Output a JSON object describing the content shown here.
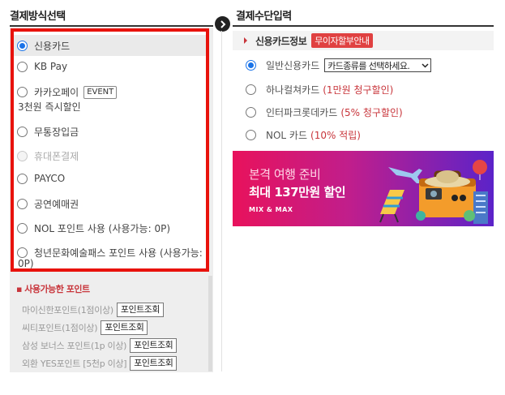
{
  "left_panel": {
    "title": "결제방식선택",
    "payment_methods": [
      {
        "label": "신용카드",
        "selected": true,
        "disabled": false
      },
      {
        "label": "KB Pay",
        "selected": false,
        "disabled": false
      },
      {
        "label": "카카오페이",
        "badge": "EVENT",
        "sub_text": "3천원 즉시할인",
        "selected": false,
        "disabled": false
      },
      {
        "label": "무통장입금",
        "selected": false,
        "disabled": false
      },
      {
        "label": "휴대폰결제",
        "selected": false,
        "disabled": true
      },
      {
        "label": "PAYCO",
        "selected": false,
        "disabled": false
      },
      {
        "label": "공연예매권",
        "selected": false,
        "disabled": false
      },
      {
        "label": "NOL 포인트 사용 (사용가능: 0P)",
        "selected": false,
        "disabled": false
      },
      {
        "label": "청년문화예술패스 포인트 사용 (사용가능:",
        "label_cont": "0P)",
        "selected": false,
        "disabled": false
      }
    ],
    "points": {
      "title": "사용가능한 포인트",
      "rows": [
        {
          "label": "마이신한포인트(1점이상)",
          "button": "포인트조회"
        },
        {
          "label": "씨티포인트(1점이상)",
          "button": "포인트조회"
        },
        {
          "label": "삼성 보너스 포인트(1p 이상)",
          "button": "포인트조회"
        },
        {
          "label": "외환 YES포인트 [5천p 이상]",
          "button": "포인트조회"
        }
      ]
    }
  },
  "right_panel": {
    "title": "결제수단입력",
    "card_info": {
      "label": "신용카드정보",
      "badge": "무이자할부안내"
    },
    "card_options": [
      {
        "label": "일반신용카드",
        "selected": true,
        "select_value": "카드종류를 선택하세요."
      },
      {
        "label": "하나컬쳐카드",
        "promo": "(1만원 청구할인)",
        "selected": false
      },
      {
        "label": "인터파크롯데카드",
        "promo": "(5% 청구할인)",
        "selected": false
      },
      {
        "label": "NOL 카드",
        "promo": "(10% 적립)",
        "selected": false
      }
    ],
    "banner": {
      "top_text": "본격 여행 준비",
      "main_text": "최대 137만원 할인",
      "brand": "MIX & MAX"
    }
  },
  "colors": {
    "highlight_border": "#e8120c",
    "accent_red": "#c8353b",
    "radio_blue": "#1a73e8"
  }
}
